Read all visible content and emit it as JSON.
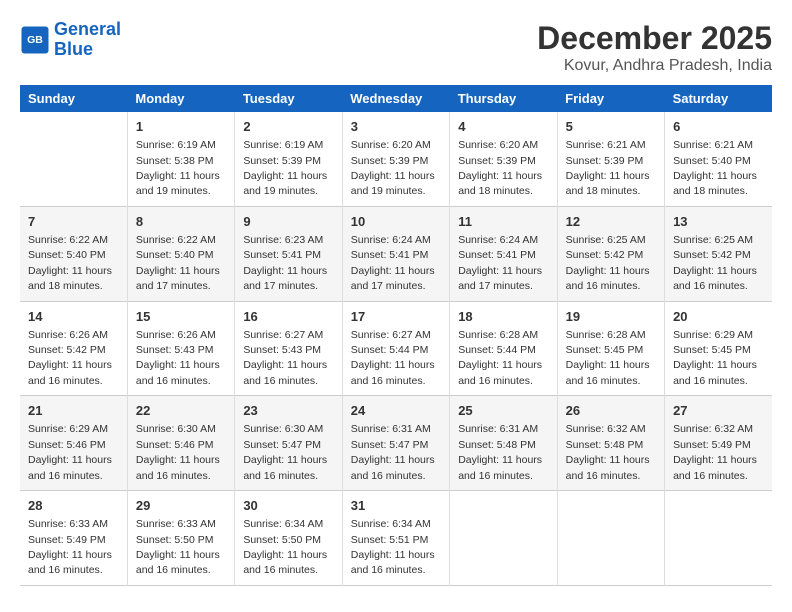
{
  "logo": {
    "line1": "General",
    "line2": "Blue"
  },
  "title": "December 2025",
  "subtitle": "Kovur, Andhra Pradesh, India",
  "headers": [
    "Sunday",
    "Monday",
    "Tuesday",
    "Wednesday",
    "Thursday",
    "Friday",
    "Saturday"
  ],
  "weeks": [
    [
      {
        "day": "",
        "sunrise": "",
        "sunset": "",
        "daylight": ""
      },
      {
        "day": "1",
        "sunrise": "Sunrise: 6:19 AM",
        "sunset": "Sunset: 5:38 PM",
        "daylight": "Daylight: 11 hours and 19 minutes."
      },
      {
        "day": "2",
        "sunrise": "Sunrise: 6:19 AM",
        "sunset": "Sunset: 5:39 PM",
        "daylight": "Daylight: 11 hours and 19 minutes."
      },
      {
        "day": "3",
        "sunrise": "Sunrise: 6:20 AM",
        "sunset": "Sunset: 5:39 PM",
        "daylight": "Daylight: 11 hours and 19 minutes."
      },
      {
        "day": "4",
        "sunrise": "Sunrise: 6:20 AM",
        "sunset": "Sunset: 5:39 PM",
        "daylight": "Daylight: 11 hours and 18 minutes."
      },
      {
        "day": "5",
        "sunrise": "Sunrise: 6:21 AM",
        "sunset": "Sunset: 5:39 PM",
        "daylight": "Daylight: 11 hours and 18 minutes."
      },
      {
        "day": "6",
        "sunrise": "Sunrise: 6:21 AM",
        "sunset": "Sunset: 5:40 PM",
        "daylight": "Daylight: 11 hours and 18 minutes."
      }
    ],
    [
      {
        "day": "7",
        "sunrise": "Sunrise: 6:22 AM",
        "sunset": "Sunset: 5:40 PM",
        "daylight": "Daylight: 11 hours and 18 minutes."
      },
      {
        "day": "8",
        "sunrise": "Sunrise: 6:22 AM",
        "sunset": "Sunset: 5:40 PM",
        "daylight": "Daylight: 11 hours and 17 minutes."
      },
      {
        "day": "9",
        "sunrise": "Sunrise: 6:23 AM",
        "sunset": "Sunset: 5:41 PM",
        "daylight": "Daylight: 11 hours and 17 minutes."
      },
      {
        "day": "10",
        "sunrise": "Sunrise: 6:24 AM",
        "sunset": "Sunset: 5:41 PM",
        "daylight": "Daylight: 11 hours and 17 minutes."
      },
      {
        "day": "11",
        "sunrise": "Sunrise: 6:24 AM",
        "sunset": "Sunset: 5:41 PM",
        "daylight": "Daylight: 11 hours and 17 minutes."
      },
      {
        "day": "12",
        "sunrise": "Sunrise: 6:25 AM",
        "sunset": "Sunset: 5:42 PM",
        "daylight": "Daylight: 11 hours and 16 minutes."
      },
      {
        "day": "13",
        "sunrise": "Sunrise: 6:25 AM",
        "sunset": "Sunset: 5:42 PM",
        "daylight": "Daylight: 11 hours and 16 minutes."
      }
    ],
    [
      {
        "day": "14",
        "sunrise": "Sunrise: 6:26 AM",
        "sunset": "Sunset: 5:42 PM",
        "daylight": "Daylight: 11 hours and 16 minutes."
      },
      {
        "day": "15",
        "sunrise": "Sunrise: 6:26 AM",
        "sunset": "Sunset: 5:43 PM",
        "daylight": "Daylight: 11 hours and 16 minutes."
      },
      {
        "day": "16",
        "sunrise": "Sunrise: 6:27 AM",
        "sunset": "Sunset: 5:43 PM",
        "daylight": "Daylight: 11 hours and 16 minutes."
      },
      {
        "day": "17",
        "sunrise": "Sunrise: 6:27 AM",
        "sunset": "Sunset: 5:44 PM",
        "daylight": "Daylight: 11 hours and 16 minutes."
      },
      {
        "day": "18",
        "sunrise": "Sunrise: 6:28 AM",
        "sunset": "Sunset: 5:44 PM",
        "daylight": "Daylight: 11 hours and 16 minutes."
      },
      {
        "day": "19",
        "sunrise": "Sunrise: 6:28 AM",
        "sunset": "Sunset: 5:45 PM",
        "daylight": "Daylight: 11 hours and 16 minutes."
      },
      {
        "day": "20",
        "sunrise": "Sunrise: 6:29 AM",
        "sunset": "Sunset: 5:45 PM",
        "daylight": "Daylight: 11 hours and 16 minutes."
      }
    ],
    [
      {
        "day": "21",
        "sunrise": "Sunrise: 6:29 AM",
        "sunset": "Sunset: 5:46 PM",
        "daylight": "Daylight: 11 hours and 16 minutes."
      },
      {
        "day": "22",
        "sunrise": "Sunrise: 6:30 AM",
        "sunset": "Sunset: 5:46 PM",
        "daylight": "Daylight: 11 hours and 16 minutes."
      },
      {
        "day": "23",
        "sunrise": "Sunrise: 6:30 AM",
        "sunset": "Sunset: 5:47 PM",
        "daylight": "Daylight: 11 hours and 16 minutes."
      },
      {
        "day": "24",
        "sunrise": "Sunrise: 6:31 AM",
        "sunset": "Sunset: 5:47 PM",
        "daylight": "Daylight: 11 hours and 16 minutes."
      },
      {
        "day": "25",
        "sunrise": "Sunrise: 6:31 AM",
        "sunset": "Sunset: 5:48 PM",
        "daylight": "Daylight: 11 hours and 16 minutes."
      },
      {
        "day": "26",
        "sunrise": "Sunrise: 6:32 AM",
        "sunset": "Sunset: 5:48 PM",
        "daylight": "Daylight: 11 hours and 16 minutes."
      },
      {
        "day": "27",
        "sunrise": "Sunrise: 6:32 AM",
        "sunset": "Sunset: 5:49 PM",
        "daylight": "Daylight: 11 hours and 16 minutes."
      }
    ],
    [
      {
        "day": "28",
        "sunrise": "Sunrise: 6:33 AM",
        "sunset": "Sunset: 5:49 PM",
        "daylight": "Daylight: 11 hours and 16 minutes."
      },
      {
        "day": "29",
        "sunrise": "Sunrise: 6:33 AM",
        "sunset": "Sunset: 5:50 PM",
        "daylight": "Daylight: 11 hours and 16 minutes."
      },
      {
        "day": "30",
        "sunrise": "Sunrise: 6:34 AM",
        "sunset": "Sunset: 5:50 PM",
        "daylight": "Daylight: 11 hours and 16 minutes."
      },
      {
        "day": "31",
        "sunrise": "Sunrise: 6:34 AM",
        "sunset": "Sunset: 5:51 PM",
        "daylight": "Daylight: 11 hours and 16 minutes."
      },
      {
        "day": "",
        "sunrise": "",
        "sunset": "",
        "daylight": ""
      },
      {
        "day": "",
        "sunrise": "",
        "sunset": "",
        "daylight": ""
      },
      {
        "day": "",
        "sunrise": "",
        "sunset": "",
        "daylight": ""
      }
    ]
  ]
}
